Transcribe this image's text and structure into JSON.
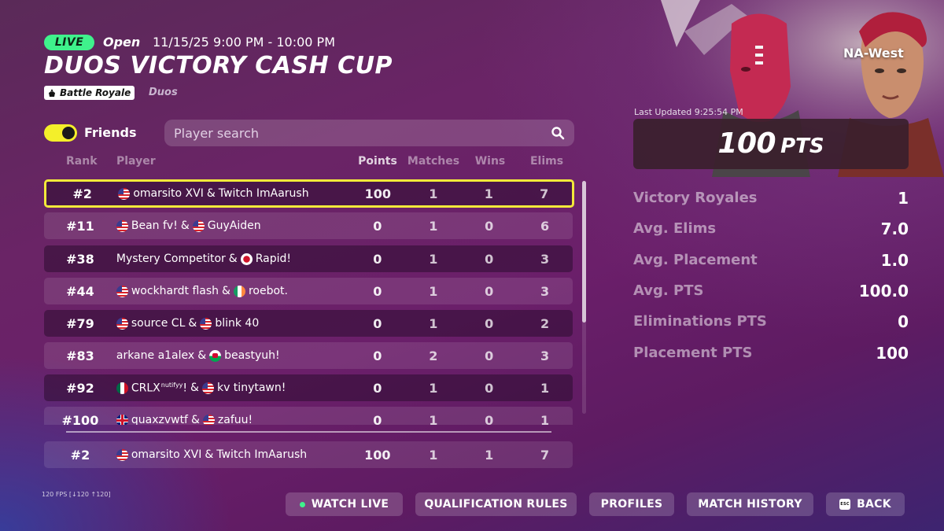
{
  "header": {
    "live_badge": "LIVE",
    "status": "Open",
    "datetime": "11/15/25 9:00 PM - 10:00 PM",
    "title": "DUOS VICTORY CASH CUP",
    "mode_chip": "Battle Royale",
    "mode_type": "Duos"
  },
  "filters": {
    "friends_label": "Friends",
    "friends_on": true,
    "search_placeholder": "Player search"
  },
  "table": {
    "columns": [
      "Rank",
      "Player",
      "Points",
      "Matches",
      "Wins",
      "Elims"
    ],
    "rows": [
      {
        "rank": "#2",
        "p1": "omarsito XVI",
        "p1_flag": "us",
        "p2": "Twitch ImAarush",
        "p2_flag": "",
        "points": "100",
        "matches": "1",
        "wins": "1",
        "elims": "7"
      },
      {
        "rank": "#11",
        "p1": "Bean fv!",
        "p1_flag": "us",
        "p2": "GuyAiden",
        "p2_flag": "us",
        "points": "0",
        "matches": "1",
        "wins": "0",
        "elims": "6"
      },
      {
        "rank": "#38",
        "p1": "Mystery Competitor",
        "p1_flag": "",
        "p2": "Rapid!",
        "p2_flag": "jp",
        "points": "0",
        "matches": "1",
        "wins": "0",
        "elims": "3"
      },
      {
        "rank": "#44",
        "p1": "wockhardt flash",
        "p1_flag": "us",
        "p2": "roebot.",
        "p2_flag": "ie",
        "points": "0",
        "matches": "1",
        "wins": "0",
        "elims": "3"
      },
      {
        "rank": "#79",
        "p1": "source CL",
        "p1_flag": "us",
        "p2": "blink 40",
        "p2_flag": "us",
        "points": "0",
        "matches": "1",
        "wins": "0",
        "elims": "2"
      },
      {
        "rank": "#83",
        "p1": "arkane a1alex",
        "p1_flag": "",
        "p2": "beastyuh!",
        "p2_flag": "wales",
        "points": "0",
        "matches": "2",
        "wins": "0",
        "elims": "3"
      },
      {
        "rank": "#92",
        "p1": "CRLX",
        "p1_sup": "nutifyy",
        "p1_suffix": "!",
        "p1_flag": "mx",
        "p2": "kv tinytawn!",
        "p2_flag": "us",
        "points": "0",
        "matches": "1",
        "wins": "0",
        "elims": "1"
      },
      {
        "rank": "#100",
        "p1": "quaxzvwtf",
        "p1_flag": "gb",
        "p2": "zafuu!",
        "p2_flag": "us",
        "points": "0",
        "matches": "1",
        "wins": "0",
        "elims": "1"
      }
    ],
    "pinned": {
      "rank": "#2",
      "p1": "omarsito XVI",
      "p1_flag": "us",
      "p2": "Twitch ImAarush",
      "points": "100",
      "matches": "1",
      "wins": "1",
      "elims": "7"
    }
  },
  "summary": {
    "region": "NA-West",
    "last_updated": "Last Updated 9:25:54 PM",
    "points_value": "100",
    "points_unit": "PTS",
    "stats": [
      {
        "label": "Victory Royales",
        "value": "1"
      },
      {
        "label": "Avg. Elims",
        "value": "7.0"
      },
      {
        "label": "Avg. Placement",
        "value": "1.0"
      },
      {
        "label": "Avg. PTS",
        "value": "100.0"
      },
      {
        "label": "Eliminations PTS",
        "value": "0"
      },
      {
        "label": "Placement PTS",
        "value": "100"
      }
    ]
  },
  "footer": {
    "fps": "120 FPS [↓120 ↑120]",
    "buttons": {
      "watch_live": "WATCH LIVE",
      "qualification_rules": "QUALIFICATION RULES",
      "profiles": "PROFILES",
      "match_history": "MATCH HISTORY",
      "back": "BACK",
      "esc_key": "ESC"
    }
  },
  "colors": {
    "live_green": "#3ff28c",
    "highlight_yellow": "#f2e93a",
    "toggle_yellow": "#f4ef2a"
  }
}
